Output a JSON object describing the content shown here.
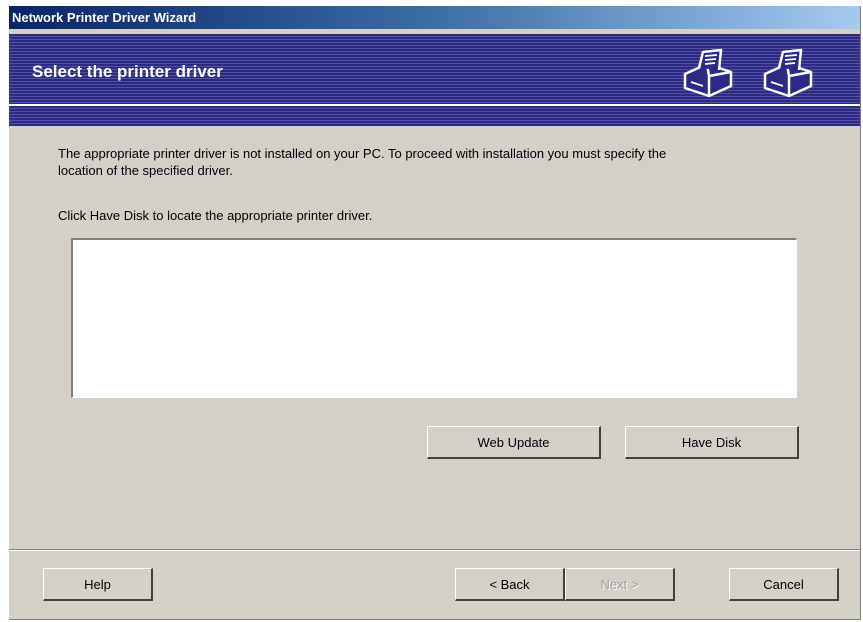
{
  "window": {
    "title": "Network Printer Driver Wizard"
  },
  "banner": {
    "title": "Select the printer driver",
    "icon": "printer-icon"
  },
  "body": {
    "description_line1": "The appropriate printer driver is not installed on your PC. To proceed with installation you must specify the",
    "description_line2": "location of the specified driver.",
    "instruction": "Click Have Disk to locate the appropriate printer driver."
  },
  "buttons": {
    "web_update": "Web Update",
    "have_disk": "Have Disk",
    "help": "Help",
    "back": "< Back",
    "next": "Next >",
    "cancel": "Cancel"
  }
}
